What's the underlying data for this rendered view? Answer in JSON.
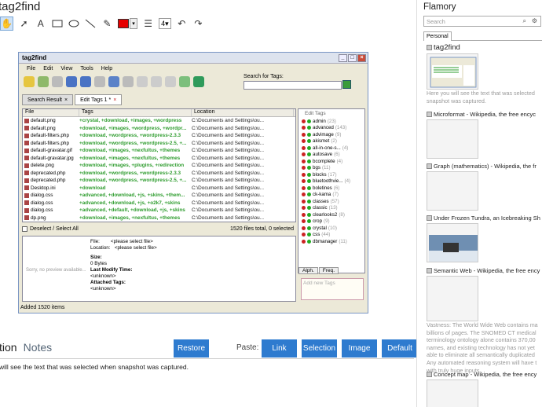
{
  "app": {
    "title": "tag2find"
  },
  "toolbar": {
    "text_tool": "A",
    "line_width": "4",
    "color": "#e60000"
  },
  "screenshot": {
    "window_title": "tag2find",
    "menu": [
      "File",
      "Edit",
      "View",
      "Tools",
      "Help"
    ],
    "search_label": "Search for Tags:",
    "tabs": [
      "Search Result",
      "Edit Tags 1 *"
    ],
    "columns": [
      "File",
      "Tags",
      "Location"
    ],
    "files": [
      {
        "file": "default.png",
        "tags": "+crystal, +download, +images, +wordpress",
        "loc": "C:\\Documents and Settings\\ou..."
      },
      {
        "file": "default.png",
        "tags": "+download, +images, +wordpress, +wordpr...",
        "loc": "C:\\Documents and Settings\\ou..."
      },
      {
        "file": "default-filters.php",
        "tags": "+download, +wordpress, +wordpress-2.3.3",
        "loc": "C:\\Documents and Settings\\ou..."
      },
      {
        "file": "default-filters.php",
        "tags": "+download, +wordpress, +wordpress-2.5, +...",
        "loc": "C:\\Documents and Settings\\ou..."
      },
      {
        "file": "default-gravatar.gif",
        "tags": "+download, +images, +nexfultus, +themes",
        "loc": "C:\\Documents and Settings\\ou..."
      },
      {
        "file": "default-gravatar.jpg",
        "tags": "+download, +images, +nexfultus, +themes",
        "loc": "C:\\Documents and Settings\\ou..."
      },
      {
        "file": "delete.png",
        "tags": "+download, +images, +plugins, +redirection",
        "loc": "C:\\Documents and Settings\\ou..."
      },
      {
        "file": "deprecated.php",
        "tags": "+download, +wordpress, +wordpress-2.3.3",
        "loc": "C:\\Documents and Settings\\ou..."
      },
      {
        "file": "deprecated.php",
        "tags": "+download, +wordpress, +wordpress-2.5, +...",
        "loc": "C:\\Documents and Settings\\ou..."
      },
      {
        "file": "Desktop.ini",
        "tags": "+download",
        "loc": "C:\\Documents and Settings\\ou..."
      },
      {
        "file": "dialog.css",
        "tags": "+advanced, +download, +js, +skins, +them...",
        "loc": "C:\\Documents and Settings\\ou..."
      },
      {
        "file": "dialog.css",
        "tags": "+advanced, +download, +js, +o2k7, +skins",
        "loc": "C:\\Documents and Settings\\ou..."
      },
      {
        "file": "dialog.css",
        "tags": "+advanced, +default, +download, +js, +skins",
        "loc": "C:\\Documents and Settings\\ou..."
      },
      {
        "file": "dp.png",
        "tags": "+download, +images, +nexfultus, +themes",
        "loc": "C:\\Documents and Settings\\ou..."
      }
    ],
    "deselect_label": "Deselect / Select All",
    "file_count": "1520 files total, 0 selected",
    "preview_empty": "Sorry, no preview available...",
    "preview_info": {
      "file_label": "File:",
      "file_value": "<please select file>",
      "location_label": "Location:",
      "location_value": "<please select file>",
      "size_label": "Size:",
      "size_value": "0 Bytes",
      "modify_label": "Last Modify Time:",
      "modify_value": "<unknown>",
      "attached_label": "Attached Tags:",
      "attached_value": "<unknown>"
    },
    "status": "Added 1520 items",
    "edit_tags_header": "Edit Tags",
    "tags": [
      {
        "name": "admin",
        "count": "(23)"
      },
      {
        "name": "advanced",
        "count": "(143)"
      },
      {
        "name": "advimage",
        "count": "(9)"
      },
      {
        "name": "akismet",
        "count": "(2)"
      },
      {
        "name": "all-in-one-s...",
        "count": "(4)"
      },
      {
        "name": "autosave",
        "count": "(6)"
      },
      {
        "name": "bcomplete",
        "count": "(4)"
      },
      {
        "name": "bgs",
        "count": "(11)"
      },
      {
        "name": "blocks",
        "count": "(17)"
      },
      {
        "name": "bluetoothvie...",
        "count": "(4)"
      },
      {
        "name": "boletines",
        "count": "(6)"
      },
      {
        "name": "ck-kama",
        "count": "(7)"
      },
      {
        "name": "classes",
        "count": "(57)"
      },
      {
        "name": "classic",
        "count": "(13)"
      },
      {
        "name": "clearlooks2",
        "count": "(8)"
      },
      {
        "name": "crop",
        "count": "(9)"
      },
      {
        "name": "crystal",
        "count": "(10)"
      },
      {
        "name": "css",
        "count": "(44)"
      },
      {
        "name": "dbmanager",
        "count": "(11)"
      }
    ],
    "tag_tabs": [
      "Alph.",
      "Freq."
    ],
    "add_tag_placeholder": "Add new Tags"
  },
  "bottom": {
    "tab_partial": "tion",
    "tab_notes": "Notes",
    "restore": "Restore",
    "paste_label": "Paste:",
    "link": "Link",
    "selection": "Selection",
    "image": "Image",
    "default": "Default",
    "caption": "will see the text that was selected when snapshot was captured."
  },
  "sidebar": {
    "title": "Flamory",
    "search_placeholder": "Search",
    "tab": "Personal",
    "entries": [
      {
        "title": "tag2find",
        "desc": [
          "Here you will see the text that was selected",
          "snapshot was captured."
        ]
      },
      {
        "title": "Microformat - Wikipedia, the free encyc",
        "desc": []
      },
      {
        "title": "Graph (mathematics) - Wikipedia, the fr",
        "desc": []
      },
      {
        "title": "Under Frozen Tundra, an Icebreaking Sh",
        "desc": []
      },
      {
        "title": "Semantic Web - Wikipedia, the free ency",
        "desc": [
          "Vastness: The World Wide Web contains ma",
          "billions of pages. The SNOMED CT medical",
          "terminology ontology alone contains 370,00",
          "names, and existing technology has not yet",
          "able to eliminate all semantically duplicated",
          "Any automated reasoning system will have t",
          "with truly huge inputs."
        ]
      },
      {
        "title": "Concept map - Wikipedia, the free ency",
        "desc": []
      }
    ]
  }
}
